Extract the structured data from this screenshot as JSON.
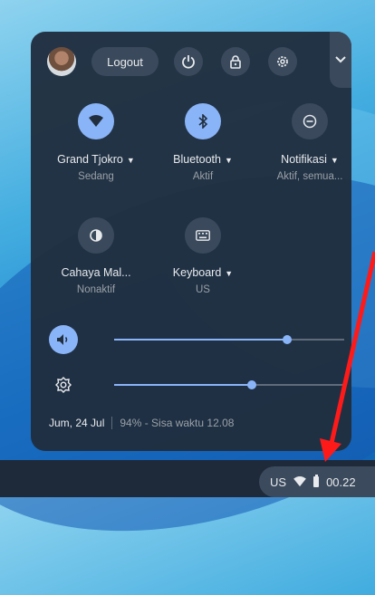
{
  "header": {
    "logout_label": "Logout"
  },
  "features": [
    {
      "label": "Grand Tjokro",
      "sublabel": "Sedang",
      "icon": "wifi-icon",
      "active": true,
      "has_menu": true
    },
    {
      "label": "Bluetooth",
      "sublabel": "Aktif",
      "icon": "bluetooth-icon",
      "active": true,
      "has_menu": true
    },
    {
      "label": "Notifikasi",
      "sublabel": "Aktif, semua...",
      "icon": "do-not-disturb-icon",
      "active": false,
      "has_menu": true
    },
    {
      "label": "Cahaya Mal...",
      "sublabel": "Nonaktif",
      "icon": "night-light-icon",
      "active": false,
      "has_menu": false
    },
    {
      "label": "Keyboard",
      "sublabel": "US",
      "icon": "keyboard-icon",
      "active": false,
      "has_menu": true
    }
  ],
  "sliders": {
    "volume": {
      "icon": "volume-icon",
      "level": 0.75
    },
    "brightness": {
      "icon": "brightness-icon",
      "level": 0.6
    }
  },
  "footer": {
    "date": "Jum, 24 Jul",
    "battery": "94% - Sisa waktu 12.08"
  },
  "tray": {
    "lang": "US",
    "time": "00.22"
  },
  "colors": {
    "accent": "#8ab4f8",
    "panel": "#202e3e",
    "annotation_arrow": "#ff0000"
  }
}
